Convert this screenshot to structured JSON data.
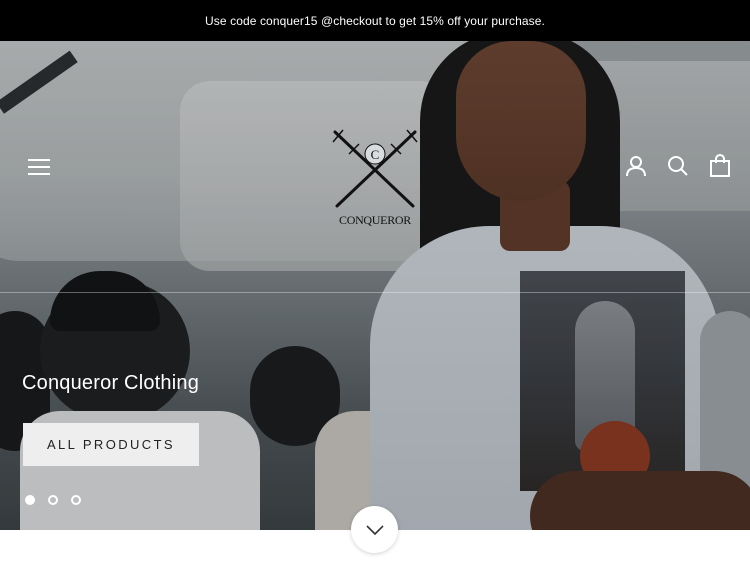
{
  "announcement": {
    "text": "Use code conquer15 @checkout to get 15% off your purchase."
  },
  "header": {
    "menu_icon": "hamburger-menu-icon",
    "logo_text": "CONQUEROR",
    "logo_monogram": "C",
    "icons": [
      "account-icon",
      "search-icon",
      "cart-bag-icon"
    ]
  },
  "hero": {
    "title": "Conqueror Clothing",
    "button_label": "ALL PRODUCTS",
    "slides": {
      "count": 3,
      "active": 1
    },
    "scroll_icon": "chevron-down-icon"
  },
  "colors": {
    "announcement_bg": "#000000",
    "announcement_text": "#ffffff",
    "button_bg": "#eeeeee",
    "button_text": "#222222",
    "hero_text": "#ffffff"
  }
}
